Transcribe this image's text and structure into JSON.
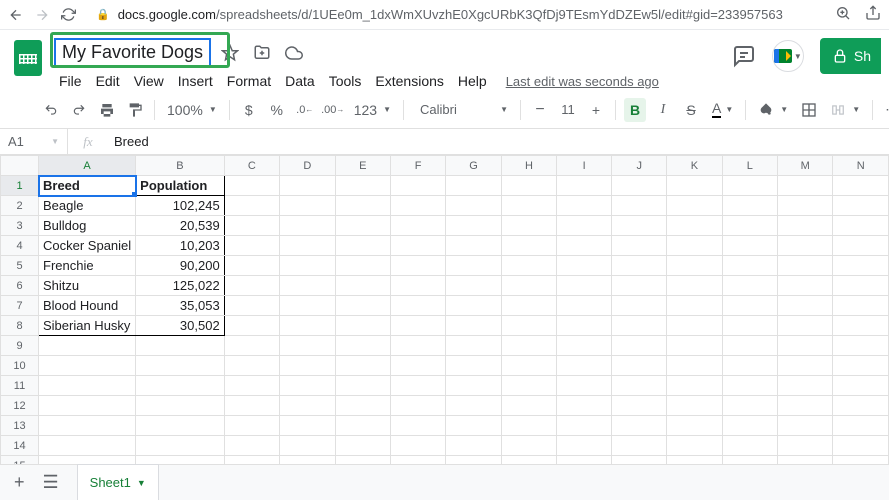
{
  "browser": {
    "url_host": "docs.google.com",
    "url_path": "/spreadsheets/d/1UEe0m_1dxWmXUvzhE0XgcURbK3QfDj9TEsmYdDZEw5l/edit#gid=233957563"
  },
  "doc": {
    "title": "My Favorite Dogs",
    "last_edit": "Last edit was seconds ago",
    "share_label": "Sh"
  },
  "menu": {
    "file": "File",
    "edit": "Edit",
    "view": "View",
    "insert": "Insert",
    "format": "Format",
    "data": "Data",
    "tools": "Tools",
    "extensions": "Extensions",
    "help": "Help"
  },
  "toolbar": {
    "zoom": "100%",
    "currency": "$",
    "percent": "%",
    "dec_dec": ".0",
    "inc_dec": ".00",
    "numfmt": "123",
    "font": "Calibri",
    "size": "11",
    "bold": "B",
    "italic": "I",
    "strike": "S",
    "textcolor": "A"
  },
  "fx": {
    "name_box": "A1",
    "formula": "Breed"
  },
  "columns": [
    "A",
    "B",
    "C",
    "D",
    "E",
    "F",
    "G",
    "H",
    "I",
    "J",
    "K",
    "L",
    "M",
    "N"
  ],
  "row_count": 15,
  "chart_data": {
    "type": "table",
    "headers": [
      "Breed",
      "Population"
    ],
    "rows": [
      [
        "Beagle",
        "102,245"
      ],
      [
        "Bulldog",
        "20,539"
      ],
      [
        "Cocker Spaniel",
        "10,203"
      ],
      [
        "Frenchie",
        "90,200"
      ],
      [
        "Shitzu",
        "125,022"
      ],
      [
        "Blood Hound",
        "35,053"
      ],
      [
        "Siberian Husky",
        "30,502"
      ]
    ]
  },
  "tabs": {
    "sheet1": "Sheet1"
  }
}
